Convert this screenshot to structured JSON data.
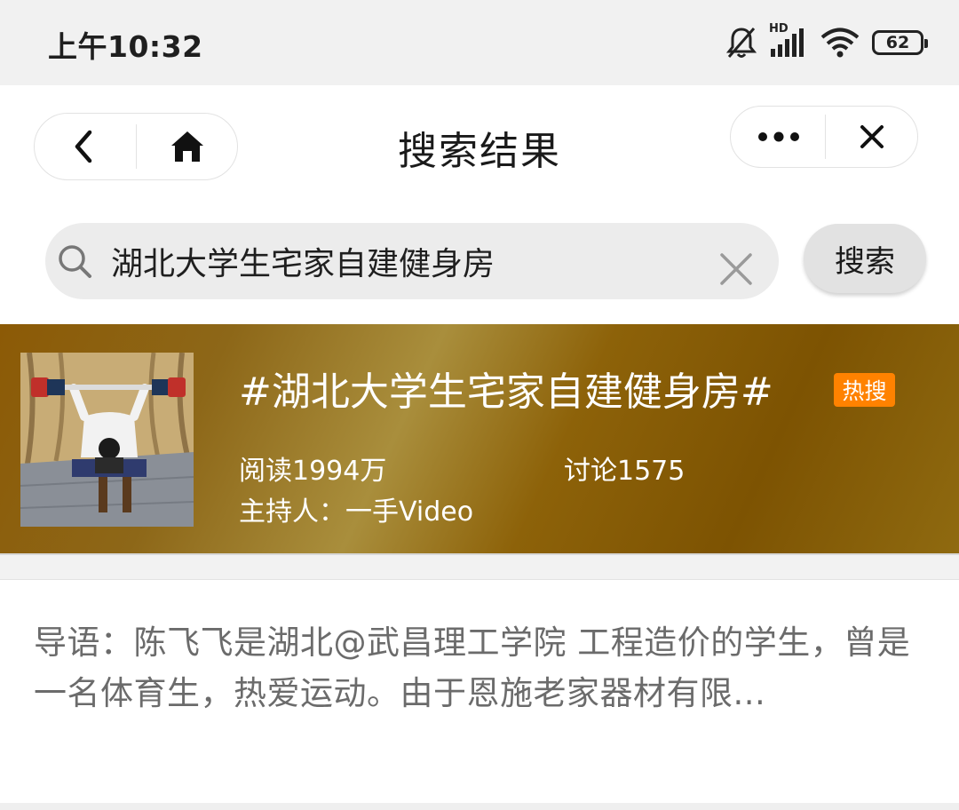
{
  "status_bar": {
    "time": "上午10:32",
    "network_label": "HD",
    "battery_level": "62"
  },
  "nav": {
    "title": "搜索结果"
  },
  "search": {
    "query": "湖北大学生宅家自建健身房",
    "button_label": "搜索"
  },
  "topic": {
    "title": "#湖北大学生宅家自建健身房#",
    "badge": "热搜",
    "reads": "阅读1994万",
    "discussions": "讨论1575",
    "host": "主持人：一手Video"
  },
  "guide": {
    "text": "导语：陈飞飞是湖北@武昌理工学院 工程造价的学生，曾是一名体育生，热爱运动。由于恩施老家器材有限..."
  },
  "icons": {
    "status": [
      "bell-muted-icon",
      "signal-icon",
      "wifi-icon",
      "battery-icon"
    ],
    "nav": [
      "back-icon",
      "home-icon",
      "more-icon",
      "close-icon"
    ],
    "search": [
      "search-icon",
      "clear-icon"
    ]
  },
  "colors": {
    "hot_badge": "#ff8200",
    "banner": "#8d6209",
    "search_bg": "#ececec",
    "guide_text": "#6b6b6b"
  }
}
